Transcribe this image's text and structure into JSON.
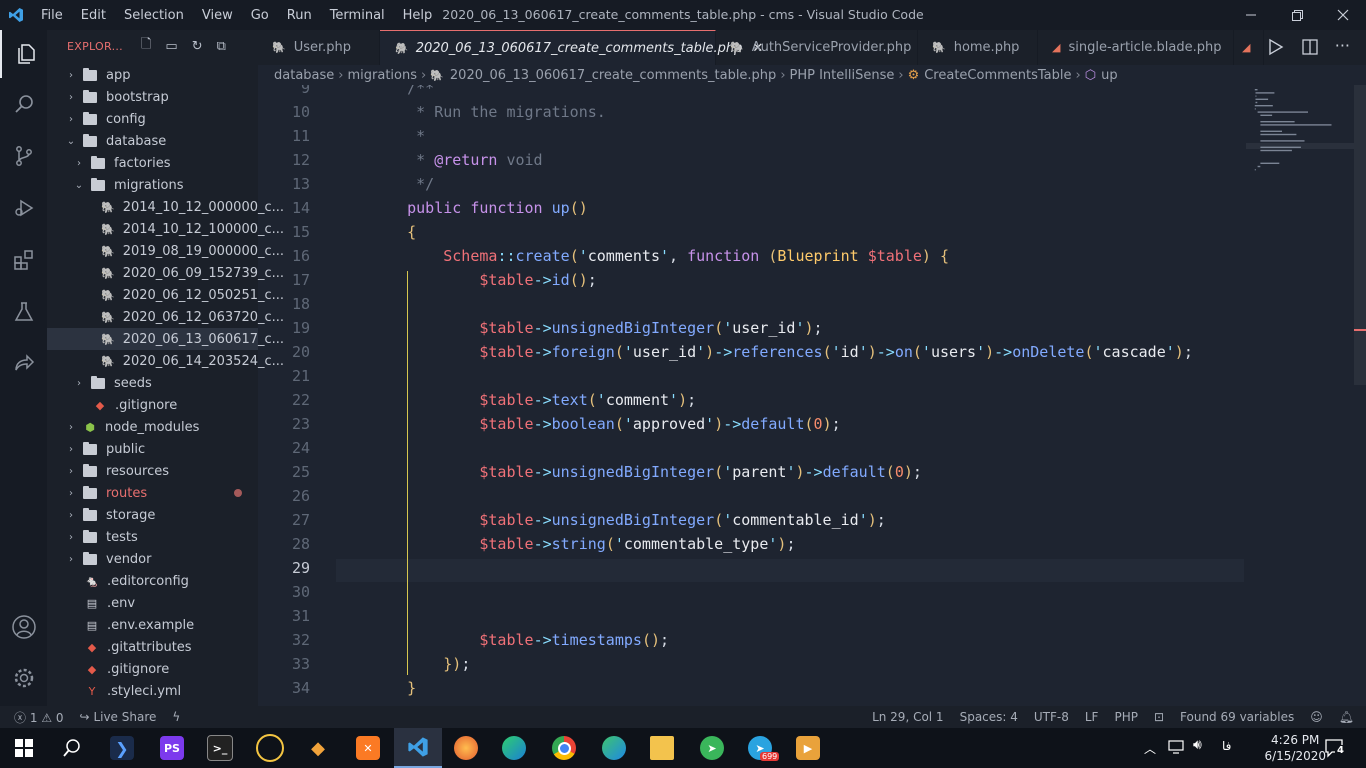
{
  "window": {
    "title": "2020_06_13_060617_create_comments_table.php - cms - Visual Studio Code",
    "menu": [
      "File",
      "Edit",
      "Selection",
      "View",
      "Go",
      "Run",
      "Terminal",
      "Help"
    ]
  },
  "sidebar": {
    "title": "EXPLOR...",
    "items": [
      {
        "label": "app",
        "kind": "folder",
        "depth": 0,
        "expanded": false
      },
      {
        "label": "bootstrap",
        "kind": "folder",
        "depth": 0,
        "expanded": false
      },
      {
        "label": "config",
        "kind": "folder",
        "depth": 0,
        "expanded": false
      },
      {
        "label": "database",
        "kind": "folder",
        "depth": 0,
        "expanded": true
      },
      {
        "label": "factories",
        "kind": "folder",
        "depth": 1,
        "expanded": false
      },
      {
        "label": "migrations",
        "kind": "folder",
        "depth": 1,
        "expanded": true
      },
      {
        "label": "2014_10_12_000000_c...",
        "kind": "php",
        "depth": 2
      },
      {
        "label": "2014_10_12_100000_c...",
        "kind": "php",
        "depth": 2
      },
      {
        "label": "2019_08_19_000000_c...",
        "kind": "php",
        "depth": 2
      },
      {
        "label": "2020_06_09_152739_c...",
        "kind": "php",
        "depth": 2
      },
      {
        "label": "2020_06_12_050251_c...",
        "kind": "php",
        "depth": 2
      },
      {
        "label": "2020_06_12_063720_c...",
        "kind": "php",
        "depth": 2
      },
      {
        "label": "2020_06_13_060617_c...",
        "kind": "php",
        "depth": 2,
        "selected": true
      },
      {
        "label": "2020_06_14_203524_c...",
        "kind": "php",
        "depth": 2
      },
      {
        "label": "seeds",
        "kind": "folder",
        "depth": 1,
        "expanded": false
      },
      {
        "label": ".gitignore",
        "kind": "git",
        "depth": 1
      },
      {
        "label": "node_modules",
        "kind": "node",
        "depth": 0,
        "expanded": false
      },
      {
        "label": "public",
        "kind": "folder",
        "depth": 0,
        "expanded": false
      },
      {
        "label": "resources",
        "kind": "folder",
        "depth": 0,
        "expanded": false
      },
      {
        "label": "routes",
        "kind": "folder",
        "depth": 0,
        "expanded": false,
        "modified": true
      },
      {
        "label": "storage",
        "kind": "folder",
        "depth": 0,
        "expanded": false
      },
      {
        "label": "tests",
        "kind": "folder",
        "depth": 0,
        "expanded": false
      },
      {
        "label": "vendor",
        "kind": "folder",
        "depth": 0,
        "expanded": false
      },
      {
        "label": ".editorconfig",
        "kind": "editorconfig",
        "depth": 0
      },
      {
        "label": ".env",
        "kind": "file",
        "depth": 0
      },
      {
        "label": ".env.example",
        "kind": "file",
        "depth": 0
      },
      {
        "label": ".gitattributes",
        "kind": "git",
        "depth": 0
      },
      {
        "label": ".gitignore",
        "kind": "git",
        "depth": 0
      },
      {
        "label": ".styleci.yml",
        "kind": "yml",
        "depth": 0
      }
    ]
  },
  "tabs": [
    {
      "label": "User.php",
      "active": false
    },
    {
      "label": "2020_06_13_060617_create_comments_table.php",
      "active": true
    },
    {
      "label": "AuthServiceProvider.php",
      "active": false
    },
    {
      "label": "home.php",
      "active": false
    },
    {
      "label": "single-article.blade.php",
      "active": false
    }
  ],
  "breadcrumb": {
    "parts": [
      "database",
      "migrations",
      "2020_06_13_060617_create_comments_table.php",
      "PHP IntelliSense",
      "CreateCommentsTable",
      "up"
    ]
  },
  "editor": {
    "current_line": 29,
    "lines": [
      {
        "n": "9",
        "text": "    /**"
      },
      {
        "n": "10",
        "text": "     * Run the migrations."
      },
      {
        "n": "11",
        "text": "     *"
      },
      {
        "n": "12",
        "text": "     * @return void"
      },
      {
        "n": "13",
        "text": "     */"
      },
      {
        "n": "14",
        "text": "    public function up()"
      },
      {
        "n": "15",
        "text": "    {"
      },
      {
        "n": "16",
        "text": "        Schema::create('comments', function (Blueprint $table) {"
      },
      {
        "n": "17",
        "text": "            $table->id();"
      },
      {
        "n": "18",
        "text": ""
      },
      {
        "n": "19",
        "text": "            $table->unsignedBigInteger('user_id');"
      },
      {
        "n": "20",
        "text": "            $table->foreign('user_id')->references('id')->on('users')->onDelete('cascade');"
      },
      {
        "n": "21",
        "text": ""
      },
      {
        "n": "22",
        "text": "            $table->text('comment');"
      },
      {
        "n": "23",
        "text": "            $table->boolean('approved')->default(0);"
      },
      {
        "n": "24",
        "text": ""
      },
      {
        "n": "25",
        "text": "            $table->unsignedBigInteger('parent')->default(0);"
      },
      {
        "n": "26",
        "text": ""
      },
      {
        "n": "27",
        "text": "            $table->unsignedBigInteger('commentable_id');"
      },
      {
        "n": "28",
        "text": "            $table->string('commentable_type');"
      },
      {
        "n": "29",
        "text": ""
      },
      {
        "n": "30",
        "text": ""
      },
      {
        "n": "31",
        "text": ""
      },
      {
        "n": "32",
        "text": "            $table->timestamps();"
      },
      {
        "n": "33",
        "text": "        });"
      },
      {
        "n": "34",
        "text": "    }"
      }
    ]
  },
  "statusbar": {
    "errors": "1",
    "warnings": "0",
    "live_share": "Live Share",
    "position": "Ln 29, Col 1",
    "spaces": "Spaces: 4",
    "encoding": "UTF-8",
    "eol": "LF",
    "language": "PHP",
    "found": "Found 69 variables"
  },
  "taskbar": {
    "time": "4:26 PM",
    "date": "6/15/2020",
    "lang": "فا",
    "notifications": "4",
    "telegram_badge": "699"
  },
  "colors": {
    "accent": "#e76f6f",
    "keyword": "#c792ea",
    "function": "#82aaff",
    "variable": "#f07178",
    "punctuation": "#89ddff",
    "number": "#f78c6c"
  }
}
